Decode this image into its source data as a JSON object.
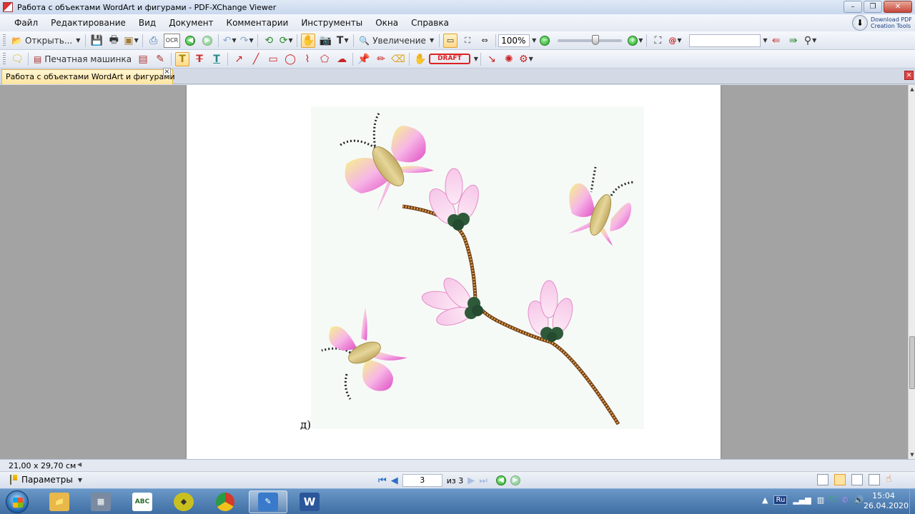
{
  "window": {
    "title": "Работа с объектами WordArt и фигурами - PDF-XChange Viewer",
    "controls": [
      "–",
      "❐",
      "✕"
    ]
  },
  "menu": {
    "items": [
      "Файл",
      "Редактирование",
      "Вид",
      "Документ",
      "Комментарии",
      "Инструменты",
      "Окна",
      "Справка"
    ]
  },
  "promo": {
    "text": "Download PDF Creation Tools"
  },
  "toolbar1": {
    "open_label": "Открыть...",
    "ocr_label": "OCR",
    "zoom_label": "Увеличение",
    "zoom_value": "100%",
    "zoom_slider_level": 0.6
  },
  "toolbar2": {
    "typewriter_label": "Печатная машинка",
    "draft_label": "DRAFT"
  },
  "tab": {
    "label": "Работа с объектами WordArt и фигурами"
  },
  "document": {
    "caption": "д)"
  },
  "status": {
    "page_size": "21,00 x 29,70 см"
  },
  "nav": {
    "params_label": "Параметры",
    "current_page": "3",
    "page_of": "из 3"
  },
  "taskbar": {
    "apps": [
      {
        "name": "explorer",
        "glyph": "📁",
        "color": "#e8b84a"
      },
      {
        "name": "calculator",
        "glyph": "▦",
        "color": "#7a8aa0"
      },
      {
        "name": "abc",
        "glyph": "ABC",
        "color": "#2a6d2a"
      },
      {
        "name": "app-shield",
        "glyph": "◆",
        "color": "#c9c020"
      },
      {
        "name": "chrome",
        "glyph": "●",
        "color": "#d53a2a"
      },
      {
        "name": "pdf-viewer",
        "glyph": "✎",
        "color": "#3a7acb"
      },
      {
        "name": "word",
        "glyph": "W",
        "color": "#2b579a"
      }
    ]
  },
  "tray": {
    "language": "Ru",
    "time": "15:04",
    "date": "26.04.2020"
  }
}
